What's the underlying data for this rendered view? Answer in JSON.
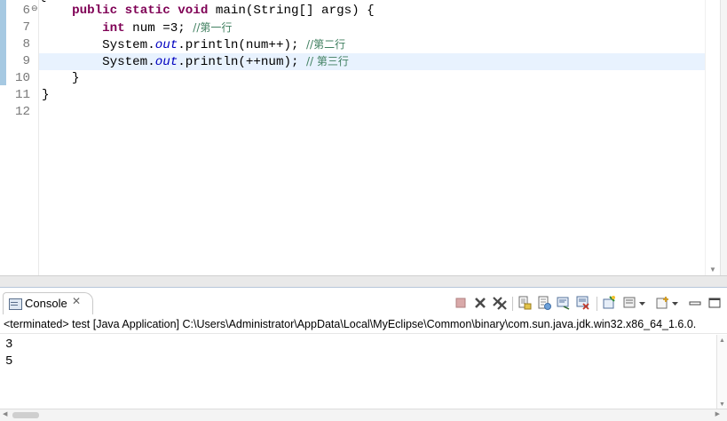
{
  "editor": {
    "top_fragment": "{",
    "lines": [
      {
        "num": "6",
        "fold": "⊖",
        "tokens": [
          {
            "t": "    ",
            "c": ""
          },
          {
            "t": "public",
            "c": "kw"
          },
          {
            "t": " ",
            "c": ""
          },
          {
            "t": "static",
            "c": "kw"
          },
          {
            "t": " ",
            "c": ""
          },
          {
            "t": "void",
            "c": "kw"
          },
          {
            "t": " main(String[] args) {",
            "c": ""
          }
        ]
      },
      {
        "num": "7",
        "tokens": [
          {
            "t": "        ",
            "c": ""
          },
          {
            "t": "int",
            "c": "kw"
          },
          {
            "t": " num =3; ",
            "c": ""
          },
          {
            "t": "//第一行",
            "c": "cmt"
          }
        ]
      },
      {
        "num": "8",
        "tokens": [
          {
            "t": "        System.",
            "c": ""
          },
          {
            "t": "out",
            "c": "fld"
          },
          {
            "t": ".println(num++); ",
            "c": ""
          },
          {
            "t": "//第二行",
            "c": "cmt"
          }
        ]
      },
      {
        "num": "9",
        "highlight": true,
        "tokens": [
          {
            "t": "        System.",
            "c": ""
          },
          {
            "t": "out",
            "c": "fld"
          },
          {
            "t": ".println(++num); ",
            "c": ""
          },
          {
            "t": "// 第三行",
            "c": "cmt"
          }
        ]
      },
      {
        "num": "10",
        "tokens": [
          {
            "t": "    }",
            "c": ""
          }
        ]
      },
      {
        "num": "11",
        "tokens": [
          {
            "t": "}",
            "c": ""
          }
        ]
      },
      {
        "num": "12",
        "tokens": []
      }
    ]
  },
  "console": {
    "tab_label": "Console",
    "tab_close": "✕",
    "status_line": "<terminated> test [Java Application] C:\\Users\\Administrator\\AppData\\Local\\MyEclipse\\Common\\binary\\com.sun.java.jdk.win32.x86_64_1.6.0.",
    "output": [
      "3",
      "5"
    ],
    "toolbar": [
      "terminate-icon",
      "remove-launch-icon",
      "remove-all-terminated-icon",
      "scroll-lock-icon",
      "word-wrap-icon",
      "pin-console-icon",
      "clear-console-icon",
      "show-on-output-icon",
      "open-console-icon",
      "display-selected-console-icon",
      "view-menu-icon",
      "minimize-icon",
      "maximize-icon"
    ]
  },
  "colors": {
    "keyword": "#7f0055",
    "field": "#0000c0",
    "comment": "#3f7f5f",
    "line_number": "#787878",
    "current_line": "#e8f2fe"
  }
}
